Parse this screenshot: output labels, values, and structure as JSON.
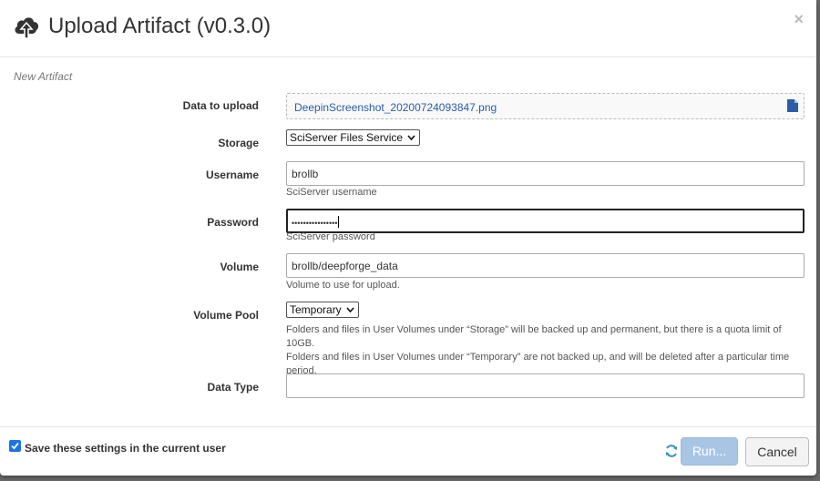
{
  "dialog": {
    "title": "Upload Artifact (v0.3.0)",
    "close_glyph": "×",
    "subtitle": "New Artifact"
  },
  "form": {
    "data_to_upload": {
      "label": "Data to upload",
      "filename": "DeepinScreenshot_20200724093847.png"
    },
    "storage": {
      "label": "Storage",
      "selected": "SciServer Files Service"
    },
    "username": {
      "label": "Username",
      "value": "brollb",
      "help": "SciServer username"
    },
    "password": {
      "label": "Password",
      "masked_value": "••••••••••••••••",
      "help": "SciServer password"
    },
    "volume": {
      "label": "Volume",
      "value": "brollb/deepforge_data",
      "help": "Volume to use for upload."
    },
    "volume_pool": {
      "label": "Volume Pool",
      "selected": "Temporary",
      "help_line1": "Folders and files in User Volumes under “Storage” will be backed up and permanent, but there is a quota limit of 10GB.",
      "help_line2": "Folders and files in User Volumes under “Temporary” are not backed up, and will be deleted after a particular time period."
    },
    "data_type": {
      "label": "Data Type",
      "value": ""
    }
  },
  "footer": {
    "save_settings_label": "Save these settings in the current user",
    "save_settings_checked": true,
    "run_label": "Run...",
    "cancel_label": "Cancel"
  },
  "icons": {
    "header": "cloud-upload-icon",
    "file": "file-icon",
    "refresh": "refresh-icon"
  },
  "colors": {
    "link": "#2a5ea8",
    "run_button": "#a9c5e6",
    "checkbox": "#1a73e8"
  }
}
